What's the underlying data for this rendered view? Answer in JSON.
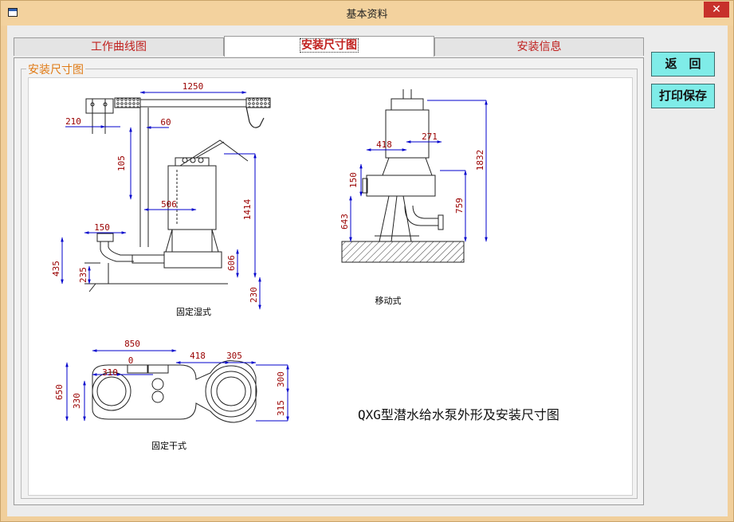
{
  "window": {
    "title": "基本资料",
    "close_glyph": "✕"
  },
  "tabs": [
    {
      "label": "工作曲线图",
      "active": false
    },
    {
      "label": "安装尺寸图",
      "active": true
    },
    {
      "label": "安装信息",
      "active": false
    }
  ],
  "group_label": "安装尺寸图",
  "buttons": {
    "back": "返　回",
    "print_save": "打印保存"
  },
  "drawing": {
    "caption": "QXG型潜水给水泵外形及安装尺寸图",
    "wet": {
      "label": "固定湿式",
      "dims": {
        "d1250": "1250",
        "d210": "210",
        "d60": "60",
        "d105": "105",
        "d506": "506",
        "d1414": "1414",
        "d150": "150",
        "d435": "435",
        "d235": "235",
        "d606": "606",
        "d230": "230"
      }
    },
    "mobile": {
      "label": "移动式",
      "dims": {
        "d418": "418",
        "d271": "271",
        "d150": "150",
        "d1832": "1832",
        "d759": "759",
        "d643": "643"
      }
    },
    "dry": {
      "label": "固定干式",
      "dims": {
        "d850": "850",
        "d0": "0",
        "d418": "418",
        "d305": "305",
        "d310": "310",
        "d650": "650",
        "d330": "330",
        "d300": "300",
        "d315": "315"
      }
    }
  }
}
